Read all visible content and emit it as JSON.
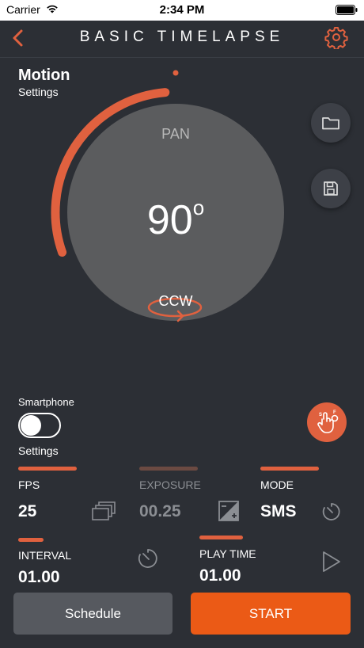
{
  "status": {
    "carrier": "Carrier",
    "time": "2:34 PM"
  },
  "nav": {
    "title": "BASIC TIMELAPSE"
  },
  "motion": {
    "title": "Motion",
    "subtitle": "Settings"
  },
  "dial": {
    "axis": "PAN",
    "angle": "90",
    "degree": "o",
    "direction": "CCW",
    "arc_fraction": 0.29
  },
  "smartphone": {
    "label": "Smartphone",
    "settings": "Settings",
    "enabled": false
  },
  "params": {
    "fps": {
      "label": "FPS",
      "value": "25"
    },
    "exposure": {
      "label": "EXPOSURE",
      "value": "00.25"
    },
    "mode": {
      "label": "MODE",
      "value": "SMS"
    },
    "interval": {
      "label": "INTERVAL",
      "value": "01.00"
    },
    "playtime": {
      "label": "PLAY TIME",
      "value": "01.00"
    }
  },
  "buttons": {
    "schedule": "Schedule",
    "start": "START"
  },
  "colors": {
    "accent": "#e0613f",
    "start": "#eb5a16",
    "bg": "#2c2f35",
    "dial": "#5b5c5e"
  }
}
